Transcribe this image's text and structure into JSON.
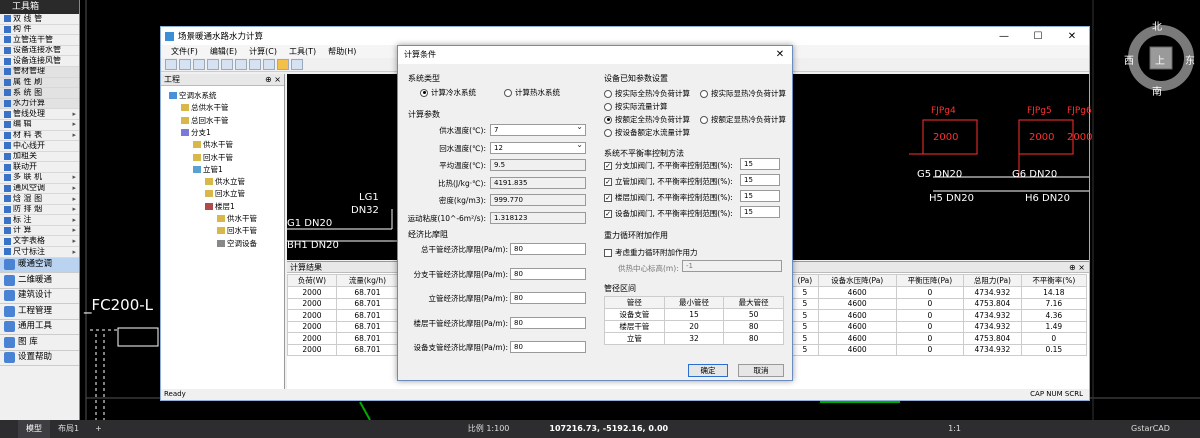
{
  "toolbox": {
    "title": "工具箱",
    "items": [
      {
        "label": "双 线 管"
      },
      {
        "label": "构    件"
      },
      {
        "label": "立管连干管"
      },
      {
        "label": "设备连接水管"
      },
      {
        "label": "设备连接风管"
      },
      {
        "label": "管材管理"
      },
      {
        "label": "属 性 刷"
      },
      {
        "label": "系 统 图"
      },
      {
        "label": "水力计算"
      },
      {
        "label": "管线处理",
        "arrow": "▸"
      },
      {
        "label": "编    辑",
        "arrow": "▸"
      },
      {
        "label": "材 料 表",
        "arrow": "▸"
      },
      {
        "label": "中心线开"
      },
      {
        "label": "加粗关"
      },
      {
        "label": "联动开"
      },
      {
        "label": "多 联 机",
        "arrow": "▸"
      },
      {
        "label": "通风空调",
        "arrow": "▸"
      },
      {
        "label": "焓 湿 图",
        "arrow": "▸"
      },
      {
        "label": "防 排 烟",
        "arrow": "▸"
      },
      {
        "label": "标    注",
        "arrow": "▸"
      },
      {
        "label": "计    算",
        "arrow": "▸"
      },
      {
        "label": "文字表格",
        "arrow": "▸"
      },
      {
        "label": "尺寸标注",
        "arrow": "▸"
      }
    ],
    "modules": [
      {
        "label": "暖通空调",
        "selected": true
      },
      {
        "label": "二维暖通"
      },
      {
        "label": "建筑设计"
      },
      {
        "label": "工程管理"
      },
      {
        "label": "通用工具"
      },
      {
        "label": "图    库"
      },
      {
        "label": "设置帮助"
      }
    ]
  },
  "cad": {
    "fc_label": "_FC200-L",
    "lg1": "LG1",
    "dn32": "DN32",
    "g1": "G1  DN20",
    "bh1": "BH1  DN20",
    "g5": "G5  DN20",
    "g6": "G6  DN20",
    "h5": "H5  DN20",
    "h6": "H6  DN20",
    "boxes": [
      {
        "tag": "FJPg4",
        "value": "2000"
      },
      {
        "tag": "FJPg5",
        "value": "2000"
      },
      {
        "tag": "FJPg6",
        "value": "2000"
      }
    ]
  },
  "app": {
    "title": "场景暖通水路水力计算",
    "menu": [
      "文件(F)",
      "编辑(E)",
      "计算(C)",
      "工具(T)",
      "帮助(H)"
    ],
    "project_panel": {
      "title": "工程",
      "pin": "⊕ ×",
      "tree": [
        {
          "label": "空调水系统",
          "level": 0,
          "icon": "system"
        },
        {
          "label": "总供水干管",
          "level": 1,
          "icon": "pipe"
        },
        {
          "label": "总回水干管",
          "level": 1,
          "icon": "pipe"
        },
        {
          "label": "分支1",
          "level": 1,
          "icon": "branch"
        },
        {
          "label": "供水干管",
          "level": 2,
          "icon": "pipe"
        },
        {
          "label": "回水干管",
          "level": 2,
          "icon": "pipe"
        },
        {
          "label": "立管1",
          "level": 2,
          "icon": "riser"
        },
        {
          "label": "供水立管",
          "level": 3,
          "icon": "pipe"
        },
        {
          "label": "回水立管",
          "level": 3,
          "icon": "pipe"
        },
        {
          "label": "楼层1",
          "level": 3,
          "icon": "floor"
        },
        {
          "label": "供水干管",
          "level": 4,
          "icon": "pipe"
        },
        {
          "label": "回水干管",
          "level": 4,
          "icon": "pipe"
        },
        {
          "label": "空调设备",
          "level": 4,
          "icon": "device"
        }
      ]
    },
    "results": {
      "title": "计算结果",
      "pin": "⊕ ×",
      "left_headers": [
        "负荷(W)",
        "流量(kg/h)"
      ],
      "left_rows": [
        [
          "2000",
          "68.701"
        ],
        [
          "2000",
          "68.701"
        ],
        [
          "2000",
          "68.701"
        ],
        [
          "2000",
          "68.701"
        ],
        [
          "2000",
          "68.701"
        ],
        [
          "2000",
          "68.701"
        ]
      ],
      "right_headers": [
        "(Pa)",
        "设备水压降(Pa)",
        "平衡压降(Pa)",
        "总阻力(Pa)",
        "不平衡率(%)"
      ],
      "right_rows": [
        [
          "5",
          "4600",
          "0",
          "4734.932",
          "14.18"
        ],
        [
          "5",
          "4600",
          "0",
          "4753.804",
          "7.16"
        ],
        [
          "5",
          "4600",
          "0",
          "4734.932",
          "4.36"
        ],
        [
          "5",
          "4600",
          "0",
          "4734.932",
          "1.49"
        ],
        [
          "5",
          "4600",
          "0",
          "4753.804",
          "0"
        ],
        [
          "5",
          "4600",
          "0",
          "4734.932",
          "0.15"
        ]
      ]
    },
    "status_left": "Ready",
    "status_right": "CAP  NUM  SCRL"
  },
  "dialog": {
    "title": "计算条件",
    "system_type": {
      "title": "系统类型",
      "options": [
        "计算冷水系统",
        "计算热水系统"
      ],
      "selected": 0
    },
    "calc_params": {
      "title": "计算参数",
      "fields": [
        {
          "label": "供水温度(℃):",
          "value": "7",
          "combo": true
        },
        {
          "label": "回水温度(℃):",
          "value": "12",
          "combo": true
        },
        {
          "label": "平均温度(℃):",
          "value": "9.5"
        },
        {
          "label": "比热(J/kg·℃):",
          "value": "4191.835"
        },
        {
          "label": "密度(kg/m3):",
          "value": "999.770"
        },
        {
          "label": "运动粘度(10^-6m²/s):",
          "value": "1.318123"
        }
      ]
    },
    "friction": {
      "title": "经济比摩阻",
      "fields": [
        {
          "label": "总干管经济比摩阻(Pa/m):",
          "value": "80"
        },
        {
          "label": "分支干管经济比摩阻(Pa/m):",
          "value": "80"
        },
        {
          "label": "立管经济比摩阻(Pa/m):",
          "value": "80"
        },
        {
          "label": "楼层干管经济比摩阻(Pa/m):",
          "value": "80"
        },
        {
          "label": "设备支管经济比摩阻(Pa/m):",
          "value": "80"
        }
      ]
    },
    "device_params": {
      "title": "设备已知参数设置",
      "options": [
        "按实际全热冷负荷计算",
        "按实际显热冷负荷计算",
        "按实际流量计算",
        "按额定全热冷负荷计算",
        "按额定显热冷负荷计算",
        "按设备额定水流量计算"
      ],
      "selected": 3
    },
    "unbalance": {
      "title": "系统不平衡率控制方法",
      "items": [
        {
          "label": "分支加阀门, 不平衡率控制范围(%):",
          "value": "15",
          "checked": true
        },
        {
          "label": "立管加阀门, 不平衡率控制范围(%):",
          "value": "15",
          "checked": true
        },
        {
          "label": "楼层加阀门, 不平衡率控制范围(%):",
          "value": "15",
          "checked": true
        },
        {
          "label": "设备加阀门, 不平衡率控制范围(%):",
          "value": "15",
          "checked": true
        }
      ]
    },
    "gravity": {
      "title": "重力循环附加作用",
      "check_label": "考虑重力循环附加作用力",
      "center_label": "供热中心标高(m):",
      "center_value": "-1"
    },
    "diameter": {
      "title": "管径区间",
      "headers": [
        "管径",
        "最小管径",
        "最大管径"
      ],
      "rows": [
        [
          "设备支管",
          "15",
          "50"
        ],
        [
          "楼层干管",
          "20",
          "80"
        ],
        [
          "立管",
          "32",
          "80"
        ]
      ]
    },
    "ok_label": "确定",
    "cancel_label": "取消"
  },
  "compass": {
    "north": "北",
    "south": "南",
    "east": "东",
    "west": "西",
    "top": "上"
  },
  "bottom": {
    "tabs": [
      "模型",
      "布局1"
    ],
    "add": "+",
    "scale": "比例 1:100",
    "coords": "107216.73, -5192.16, 0.00",
    "ratio": "1:1",
    "app": "GstarCAD"
  }
}
